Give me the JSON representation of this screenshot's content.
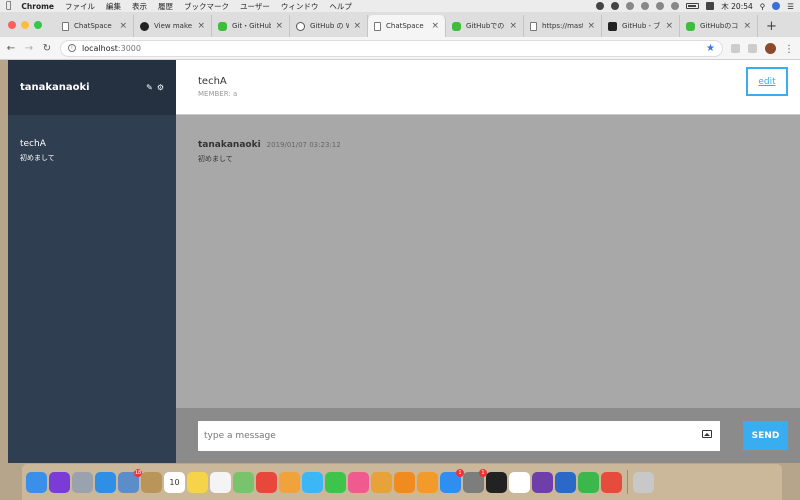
{
  "menubar": {
    "app_name": "Chrome",
    "items": [
      "ファイル",
      "編集",
      "表示",
      "履歴",
      "ブックマーク",
      "ユーザー",
      "ウィンドウ",
      "ヘルプ"
    ],
    "clock": "木 20:54",
    "battery": "",
    "text_icon": "A"
  },
  "tabs": [
    {
      "label": "ChatSpace",
      "icon": "doc-icon",
      "active": false
    },
    {
      "label": "View make s",
      "icon": "github-icon",
      "active": false
    },
    {
      "label": "Git・GitHub",
      "icon": "evernote-icon",
      "active": false
    },
    {
      "label": "GitHub の Wi",
      "icon": "wiki-icon",
      "active": false
    },
    {
      "label": "ChatSpace",
      "icon": "doc-icon",
      "active": true
    },
    {
      "label": "GitHubでのブ",
      "icon": "evernote-icon",
      "active": false
    },
    {
      "label": "https://maste",
      "icon": "doc-icon",
      "active": false
    },
    {
      "label": "GitHub - ブル",
      "icon": "y-icon",
      "active": false
    },
    {
      "label": "GitHubのコメ",
      "icon": "evernote-icon",
      "active": false
    }
  ],
  "address": {
    "host": "localhost",
    "port": ":3000"
  },
  "sidebar": {
    "user_name": "tanakanaoki",
    "groups": [
      {
        "name": "techA",
        "last_message": "初めまして"
      }
    ]
  },
  "main": {
    "group_name": "techA",
    "members_label": "MEMBER: a",
    "edit_label": "edit",
    "messages": [
      {
        "user": "tanakanaoki",
        "time": "2019/01/07 03:23:12",
        "text": "初めまして"
      }
    ]
  },
  "form": {
    "placeholder": "type a message",
    "send_label": "SEND"
  },
  "dock": {
    "apps": [
      {
        "name": "finder-icon",
        "color": "#3a8fe8"
      },
      {
        "name": "siri-icon",
        "color": "#7a3bd6"
      },
      {
        "name": "launchpad-icon",
        "color": "#9aa3ad"
      },
      {
        "name": "safari-icon",
        "color": "#2f8fe6"
      },
      {
        "name": "preview-icon",
        "color": "#5b8ec9",
        "badge": "18"
      },
      {
        "name": "notes-book-icon",
        "color": "#b9955a"
      },
      {
        "name": "calendar-icon",
        "color": "#ffffff",
        "badge_text": "10"
      },
      {
        "name": "notes-icon",
        "color": "#f6d44a"
      },
      {
        "name": "reminders-icon",
        "color": "#f4f4f4"
      },
      {
        "name": "maps-icon",
        "color": "#78c36b"
      },
      {
        "name": "chrome-icon",
        "color": "#e8473b"
      },
      {
        "name": "photos-icon",
        "color": "#f0a23b"
      },
      {
        "name": "messages-icon",
        "color": "#3cb7f6"
      },
      {
        "name": "facetime-icon",
        "color": "#3ec44b"
      },
      {
        "name": "itunes-icon",
        "color": "#f05a8e"
      },
      {
        "name": "sequel-icon",
        "color": "#e8a23a"
      },
      {
        "name": "sublime-icon",
        "color": "#f08c1f"
      },
      {
        "name": "ibooks-icon",
        "color": "#f29b2a"
      },
      {
        "name": "appstore-icon",
        "color": "#2f8ff0",
        "badge": "1"
      },
      {
        "name": "system-prefs-icon",
        "color": "#7d7d7d",
        "badge": "1"
      },
      {
        "name": "terminal-icon",
        "color": "#222222"
      },
      {
        "name": "slack-icon",
        "color": "#ffffff"
      },
      {
        "name": "github-desktop-icon",
        "color": "#6e3fa8"
      },
      {
        "name": "sourcetree-icon",
        "color": "#2a69c7"
      },
      {
        "name": "evernote-icon",
        "color": "#3cb74b"
      },
      {
        "name": "photo-editor-icon",
        "color": "#e64c3c"
      },
      {
        "name": "trash-icon",
        "color": "#c8c8c8"
      }
    ]
  }
}
